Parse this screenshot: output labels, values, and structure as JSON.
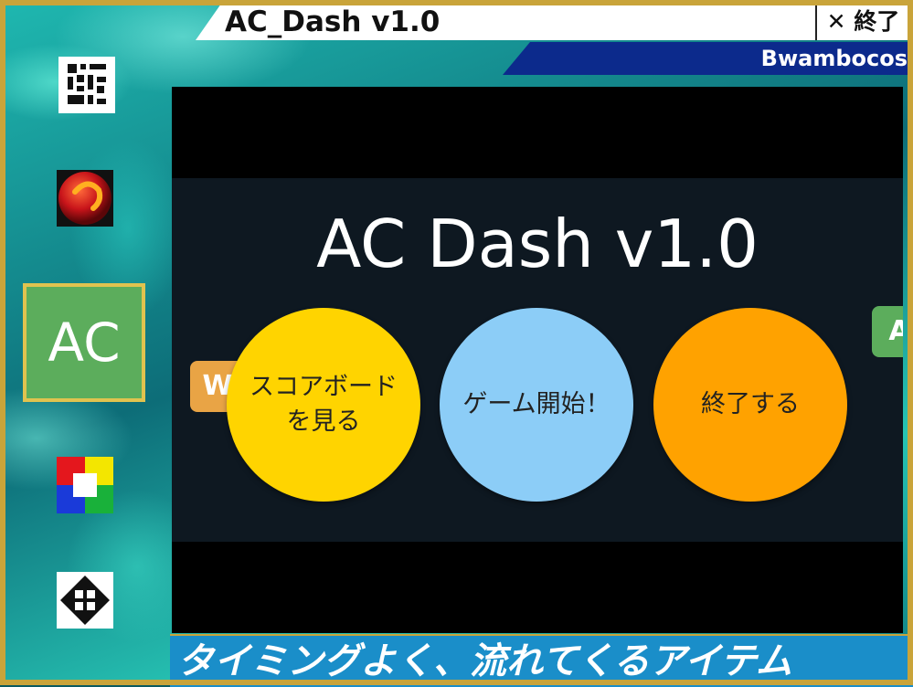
{
  "window": {
    "title": "AC_Dash v1.0",
    "close_label": "✕ 終了",
    "user_name": "Bwambocos"
  },
  "dock": {
    "items": [
      {
        "name": "qr-app-icon"
      },
      {
        "name": "red-ball-app-icon"
      },
      {
        "name": "ac-dash-app-icon",
        "label": "AC",
        "selected": true
      },
      {
        "name": "color-tiles-app-icon"
      },
      {
        "name": "pattern-app-icon"
      }
    ]
  },
  "game": {
    "title": "AC Dash v1.0",
    "left_card_partial": "W",
    "right_card_partial": "A",
    "buttons": [
      {
        "label": "スコアボードを見る",
        "color": "#ffd400"
      },
      {
        "label": "ゲーム開始！",
        "color": "#8ccdf7"
      },
      {
        "label": "終了する",
        "color": "#ffa200"
      }
    ]
  },
  "ticker": {
    "text": "タイミングよく、流れてくるアイテム"
  },
  "colors": {
    "frame": "#c9a43a",
    "user_bar": "#0c2a8c",
    "ticker": "#1a8ec9",
    "panel": "#0e1821",
    "selected_dock": "#5cad5c"
  }
}
